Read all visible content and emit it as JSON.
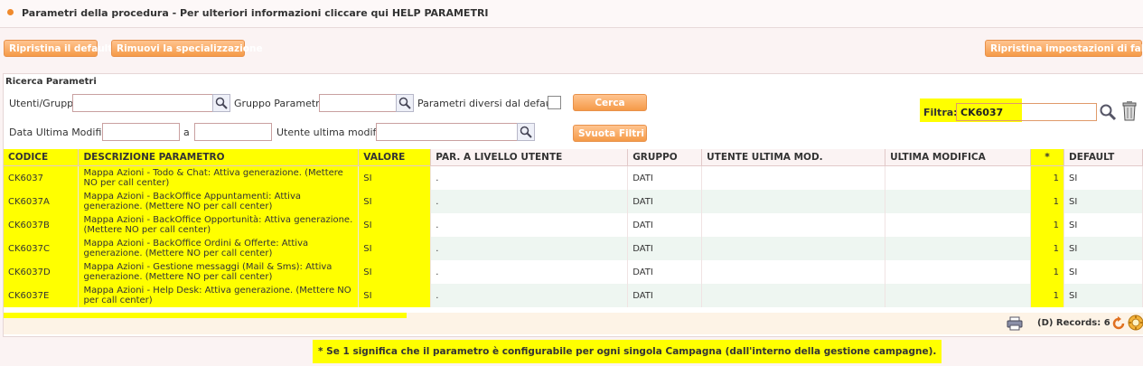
{
  "title": "Parametri della procedura - Per ulteriori informazioni cliccare qui HELP PARAMETRI",
  "toolbar": {
    "restore_default": "Ripristina il default",
    "remove_spec": "Rimuovi la specializzazione",
    "restore_factory": "Ripristina impostazioni di fabbrica"
  },
  "search": {
    "section_title": "Ricerca Parametri",
    "users_groups_label": "Utenti/Gruppi",
    "param_group_label": "Gruppo Parametro",
    "diff_from_default_label": "Parametri diversi dal default",
    "search_button": "Cerca",
    "last_mod_date_label": "Data Ultima Modifica",
    "to_label": "a",
    "last_mod_user_label": "Utente ultima modifica",
    "clear_filters_button": "Svuota Filtri",
    "filter_label": "Filtra:",
    "filter_value": "CK6037"
  },
  "table": {
    "headers": [
      "CODICE",
      "DESCRIZIONE PARAMETRO",
      "VALORE",
      "PAR. A LIVELLO UTENTE",
      "GRUPPO",
      "UTENTE ULTIMA MOD.",
      "ULTIMA MODIFICA",
      "*",
      "DEFAULT"
    ],
    "rows": [
      {
        "code": "CK6037",
        "desc": "Mappa Azioni - Todo & Chat: Attiva generazione. (Mettere NO per call center)",
        "value": "SI",
        "user_level": ".",
        "group": "DATI",
        "user_mod": "",
        "last_mod": "",
        "star": "1",
        "default": "SI"
      },
      {
        "code": "CK6037A",
        "desc": "Mappa Azioni - BackOffice Appuntamenti: Attiva generazione. (Mettere NO per call center)",
        "value": "SI",
        "user_level": ".",
        "group": "DATI",
        "user_mod": "",
        "last_mod": "",
        "star": "1",
        "default": "SI"
      },
      {
        "code": "CK6037B",
        "desc": "Mappa Azioni - BackOffice Opportunità: Attiva generazione. (Mettere NO per call center)",
        "value": "SI",
        "user_level": ".",
        "group": "DATI",
        "user_mod": "",
        "last_mod": "",
        "star": "1",
        "default": "SI"
      },
      {
        "code": "CK6037C",
        "desc": "Mappa Azioni - BackOffice Ordini & Offerte: Attiva generazione. (Mettere NO per call center)",
        "value": "SI",
        "user_level": ".",
        "group": "DATI",
        "user_mod": "",
        "last_mod": "",
        "star": "1",
        "default": "SI"
      },
      {
        "code": "CK6037D",
        "desc": "Mappa Azioni - Gestione messaggi (Mail & Sms): Attiva generazione. (Mettere NO per call center)",
        "value": "SI",
        "user_level": ".",
        "group": "DATI",
        "user_mod": "",
        "last_mod": "",
        "star": "1",
        "default": "SI"
      },
      {
        "code": "CK6037E",
        "desc": "Mappa Azioni - Help Desk: Attiva generazione. (Mettere NO per call center)",
        "value": "SI",
        "user_level": ".",
        "group": "DATI",
        "user_mod": "",
        "last_mod": "",
        "star": "1",
        "default": "SI"
      }
    ]
  },
  "footer": {
    "records_text": "(D) Records: 6"
  },
  "note": "* Se 1 significa che il parametro è configurabile per ogni singola Campagna (dall'interno della gestione campagne).",
  "colors": {
    "accent": "#f59a48",
    "highlight": "#ffff00"
  }
}
